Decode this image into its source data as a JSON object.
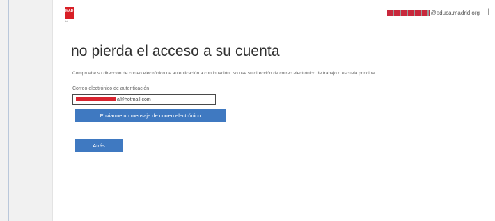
{
  "header": {
    "logo_text": "MAD",
    "logo_sub": "rid",
    "user_email_suffix": "@educa.madrid.org",
    "separator": "|"
  },
  "main": {
    "title": "no pierda el acceso a su cuenta",
    "instructions": "Compruebe su dirección de correo electrónico de autenticación a continuación. No use su dirección de correo electrónico de trabajo o escuela principal.",
    "field_label": "Correo electrónico de autenticación",
    "email_suffix": "a@hotmail.com",
    "send_button_label": "Enviarme un mensaje de correo electrónico",
    "back_button_label": "Atrás"
  },
  "colors": {
    "accent": "#3f79c1",
    "brand": "#d81f26"
  },
  "icons": {
    "logo": "comunidad-madrid-logo"
  }
}
